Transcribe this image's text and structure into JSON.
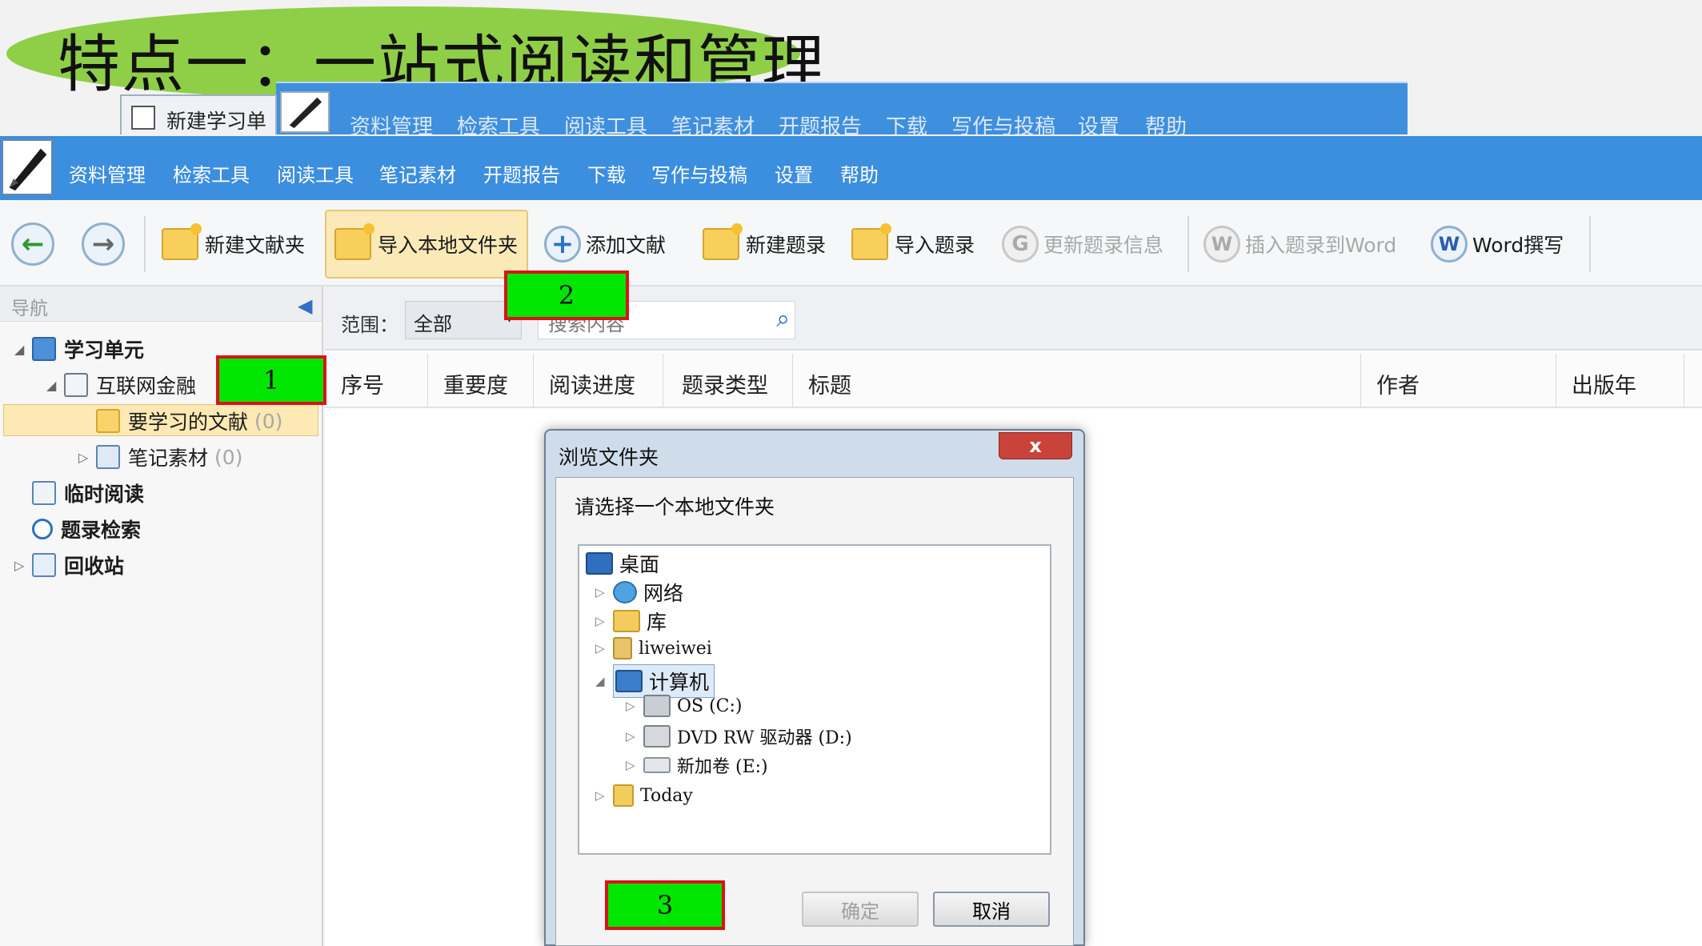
{
  "slide_title": "特点一：一站式阅读和管理",
  "bg_window": {
    "tab_label": "新建学习单",
    "menu": [
      "资料管理",
      "检索工具",
      "阅读工具",
      "笔记素材",
      "开题报告",
      "下载",
      "写作与投稿",
      "设置",
      "帮助"
    ]
  },
  "menu": [
    "资料管理",
    "检索工具",
    "阅读工具",
    "笔记素材",
    "开题报告",
    "下载",
    "写作与投稿",
    "设置",
    "帮助"
  ],
  "toolbar": {
    "back_icon": "back-arrow-icon",
    "forward_icon": "forward-arrow-icon",
    "new_folder": "新建文献夹",
    "import_local": "导入本地文件夹",
    "add_doc": "添加文献",
    "new_record": "新建题录",
    "import_record": "导入题录",
    "update_record": "更新题录信息",
    "insert_word": "插入题录到Word",
    "word_write": "Word撰写"
  },
  "nav": {
    "title": "导航",
    "items": [
      {
        "label": "学习单元"
      },
      {
        "label": "互联网金融"
      },
      {
        "label": "要学习的文献",
        "count": "(0)"
      },
      {
        "label": "笔记素材",
        "count": "(0)"
      },
      {
        "label": "临时阅读"
      },
      {
        "label": "题录检索"
      },
      {
        "label": "回收站"
      }
    ]
  },
  "filter": {
    "range_label": "范围：",
    "range_value": "全部",
    "search_placeholder": "搜索内容"
  },
  "table": {
    "columns": [
      "序号",
      "重要度",
      "阅读进度",
      "题录类型",
      "标题",
      "作者",
      "出版年"
    ]
  },
  "badges": [
    "1",
    "2",
    "3"
  ],
  "dialog": {
    "title": "浏览文件夹",
    "close": "x",
    "prompt": "请选择一个本地文件夹",
    "tree": [
      {
        "label": "桌面"
      },
      {
        "label": "网络"
      },
      {
        "label": "库"
      },
      {
        "label": "liweiwei"
      },
      {
        "label": "计算机"
      },
      {
        "label": "OS (C:)"
      },
      {
        "label": "DVD RW 驱动器 (D:)"
      },
      {
        "label": "新加卷 (E:)"
      },
      {
        "label": "Today"
      }
    ],
    "ok": "确定",
    "cancel": "取消"
  },
  "colors": {
    "menubar": "#3c8edf",
    "title_bubble": "#8fcf48",
    "badge_fill": "#00e600",
    "badge_border": "#d8141a"
  }
}
